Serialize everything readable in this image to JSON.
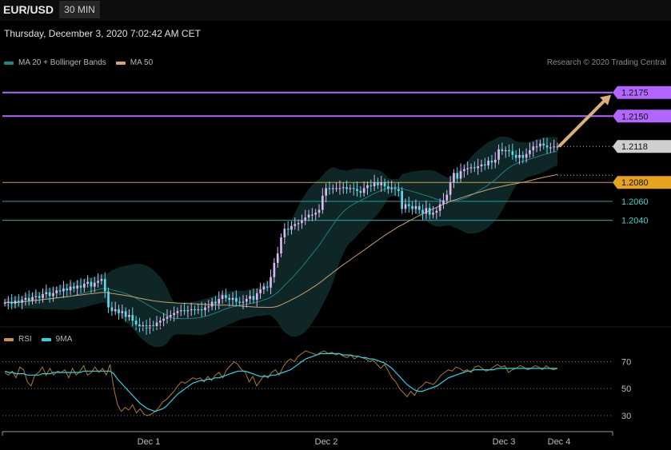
{
  "header": {
    "symbol": "EUR/USD",
    "timeframe": "30 MIN",
    "datetime": "Thursday, December 3, 2020 7:02:42 AM CET",
    "credit": "Research © 2020 Trading Central"
  },
  "legend_main": [
    {
      "label": "MA 20 + Bollinger Bands",
      "color": "#1a8a8a"
    },
    {
      "label": "MA 50",
      "color": "#d2a679"
    }
  ],
  "legend_rsi": [
    {
      "label": "RSI",
      "color": "#c8963c"
    },
    {
      "label": "9MA",
      "color": "#2ad4e6"
    }
  ],
  "colors": {
    "resistance": "#b366ff",
    "current": "#cfcfcf",
    "pivot": "#e6a320",
    "support": "#1f8f8f",
    "up_candle": "#d8b8f0",
    "down_candle": "#5fd8e8",
    "arrow": "#d8b078",
    "bands": "#0f2a2a"
  },
  "chart_data": [
    {
      "type": "candlestick",
      "title": "EUR/USD",
      "ylim": [
        1.1935,
        1.2195
      ],
      "x_ticks": [
        "Dec 1",
        "Dec 2",
        "Dec 3",
        "Dec 4"
      ],
      "levels": [
        {
          "value": 1.2175,
          "label": "1.2175",
          "kind": "resistance"
        },
        {
          "value": 1.215,
          "label": "1.2150",
          "kind": "resistance"
        },
        {
          "value": 1.2118,
          "label": "1.2118",
          "kind": "current"
        },
        {
          "value": 1.208,
          "label": "1.2080",
          "kind": "pivot"
        },
        {
          "value": 1.206,
          "label": "1.2060",
          "kind": "support"
        },
        {
          "value": 1.204,
          "label": "1.2040",
          "kind": "support"
        }
      ],
      "close": [
        1.1953,
        1.1954,
        1.1952,
        1.1955,
        1.1953,
        1.1956,
        1.1958,
        1.1955,
        1.1959,
        1.196,
        1.1958,
        1.1962,
        1.1964,
        1.196,
        1.1963,
        1.1966,
        1.1965,
        1.1968,
        1.1966,
        1.197,
        1.1968,
        1.1971,
        1.1969,
        1.1973,
        1.1975,
        1.197,
        1.1974,
        1.1976,
        1.1978,
        1.1965,
        1.1948,
        1.1944,
        1.1946,
        1.1942,
        1.1944,
        1.1938,
        1.194,
        1.1934,
        1.193,
        1.1927,
        1.1929,
        1.1926,
        1.1929,
        1.1928,
        1.1932,
        1.1934,
        1.1936,
        1.1938,
        1.194,
        1.1942,
        1.1944,
        1.1945,
        1.1944,
        1.1945,
        1.1946,
        1.1945,
        1.1946,
        1.1945,
        1.1948,
        1.1949,
        1.1954,
        1.1952,
        1.1957,
        1.1961,
        1.1958,
        1.1956,
        1.1958,
        1.1954,
        1.1953,
        1.1954,
        1.1957,
        1.196,
        1.1956,
        1.1963,
        1.1967,
        1.197,
        1.1969,
        1.198,
        1.1995,
        1.2005,
        1.2022,
        1.2031,
        1.203,
        1.2034,
        1.2036,
        1.2037,
        1.204,
        1.2043,
        1.2046,
        1.2046,
        1.2048,
        1.2051,
        1.2066,
        1.2074,
        1.2073,
        1.2074,
        1.2074,
        1.2074,
        1.2075,
        1.2073,
        1.2074,
        1.2073,
        1.2071,
        1.2069,
        1.2074,
        1.2077,
        1.2076,
        1.208,
        1.2077,
        1.208,
        1.2076,
        1.2073,
        1.2074,
        1.2073,
        1.2071,
        1.2052,
        1.2057,
        1.2055,
        1.2052,
        1.2055,
        1.2051,
        1.2047,
        1.2053,
        1.2046,
        1.2048,
        1.205,
        1.2057,
        1.2061,
        1.2067,
        1.208,
        1.209,
        1.2084,
        1.2092,
        1.2094,
        1.2095,
        1.2096,
        1.2095,
        1.2097,
        1.2099,
        1.2098,
        1.2103,
        1.2101,
        1.2104,
        1.2115,
        1.2113,
        1.2114,
        1.2113,
        1.2109,
        1.2106,
        1.2109,
        1.2106,
        1.211,
        1.2114,
        1.2118,
        1.2118,
        1.2121,
        1.2119,
        1.2117,
        1.2117,
        1.2118,
        1.2118
      ]
    },
    {
      "type": "line",
      "title": "RSI",
      "ylim": [
        24,
        78
      ],
      "y_ticks": [
        70,
        50,
        30
      ],
      "series": [
        {
          "name": "RSI",
          "values": [
            62,
            60,
            63,
            58,
            66,
            64,
            55,
            52,
            60,
            62,
            66,
            60,
            65,
            60,
            63,
            62,
            64,
            58,
            65,
            60,
            63,
            67,
            60,
            62,
            66,
            62,
            65,
            60,
            68,
            50,
            38,
            33,
            36,
            34,
            38,
            32,
            35,
            31,
            30,
            31,
            33,
            36,
            40,
            42,
            45,
            48,
            52,
            55,
            54,
            56,
            58,
            57,
            58,
            55,
            59,
            56,
            60,
            62,
            58,
            64,
            67,
            70,
            68,
            64,
            62,
            55,
            59,
            52,
            56,
            60,
            58,
            62,
            64,
            60,
            66,
            70,
            72,
            70,
            74,
            76,
            78,
            77,
            76,
            75,
            77,
            78,
            76,
            77,
            75,
            76,
            74,
            73,
            75,
            72,
            74,
            73,
            72,
            70,
            71,
            68,
            65,
            68,
            63,
            58,
            55,
            50,
            47,
            44,
            48,
            45,
            50,
            52,
            55,
            54,
            53,
            56,
            60,
            62,
            64,
            63,
            66,
            65,
            63,
            64,
            62,
            66,
            67,
            65,
            63,
            64,
            66,
            68,
            66,
            67,
            62,
            64,
            65,
            67,
            66,
            64,
            65,
            67,
            66,
            64,
            67,
            65,
            64,
            65
          ]
        },
        {
          "name": "9MA",
          "values": [
            63,
            62,
            62,
            61,
            61,
            61,
            60,
            60,
            60,
            60,
            61,
            61,
            61,
            62,
            62,
            62,
            62,
            62,
            62,
            62,
            62,
            63,
            63,
            63,
            63,
            63,
            63,
            63,
            63,
            61,
            57,
            54,
            51,
            48,
            45,
            42,
            39,
            37,
            35,
            34,
            33,
            34,
            35,
            37,
            40,
            43,
            46,
            48,
            50,
            52,
            54,
            55,
            56,
            56,
            57,
            57,
            58,
            58,
            59,
            60,
            61,
            62,
            63,
            63,
            63,
            62,
            61,
            60,
            59,
            59,
            59,
            60,
            60,
            61,
            62,
            63,
            64,
            66,
            68,
            70,
            72,
            73,
            74,
            75,
            76,
            76,
            76,
            76,
            76,
            76,
            75,
            75,
            75,
            74,
            74,
            73,
            73,
            72,
            72,
            71,
            70,
            69,
            67,
            65,
            62,
            59,
            56,
            53,
            51,
            49,
            48,
            48,
            49,
            50,
            51,
            52,
            54,
            56,
            58,
            59,
            60,
            61,
            62,
            63,
            63,
            64,
            64,
            64,
            64,
            64,
            64,
            65,
            65,
            65,
            65,
            65,
            65,
            65,
            65,
            65,
            65,
            65,
            65,
            65,
            65,
            65,
            65,
            65
          ]
        }
      ]
    }
  ]
}
